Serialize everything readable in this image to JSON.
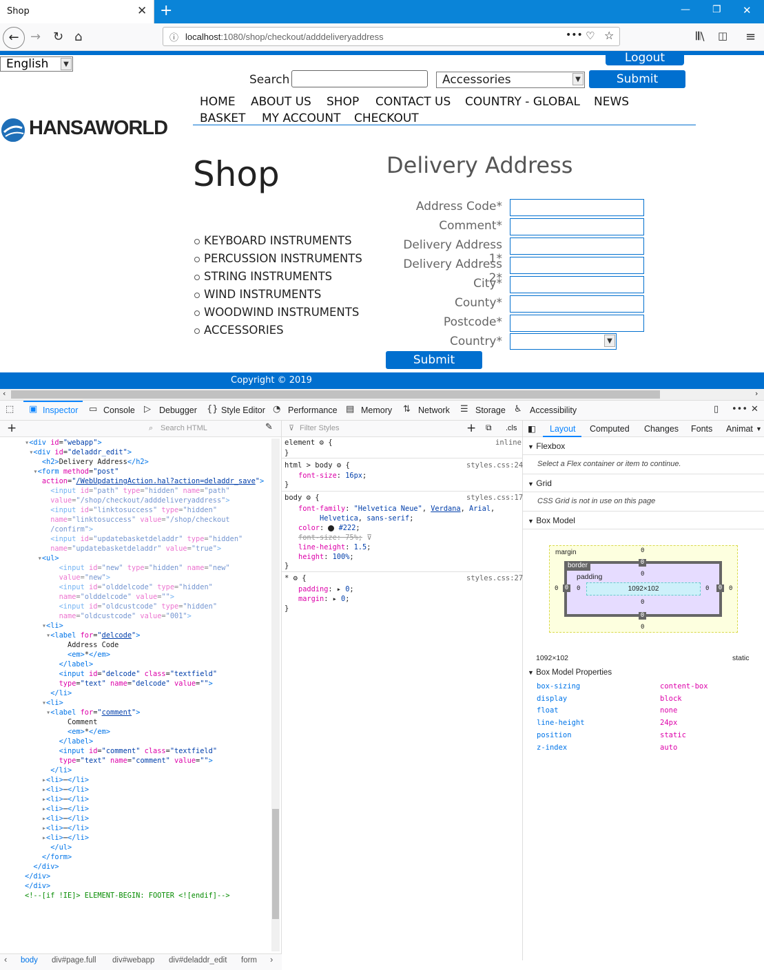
{
  "browser": {
    "tab_title": "Shop",
    "url_host": "localhost",
    "url_rest": ":1080/shop/checkout/adddeliveryaddress",
    "icons": [
      "back-icon",
      "forward-icon",
      "reload-icon",
      "home-icon",
      "info-icon",
      "more-icon",
      "pocket-icon",
      "bookmark-star-icon",
      "library-icon",
      "sidebar-icon",
      "menu-icon"
    ]
  },
  "page": {
    "language": "English",
    "logout": "Logout",
    "search_label": "Search",
    "search_value": "",
    "category_select": "Accessories",
    "submit": "Submit",
    "nav": [
      "HOME",
      "ABOUT US",
      "SHOP",
      "CONTACT US",
      "COUNTRY - GLOBAL",
      "NEWS"
    ],
    "nav2": [
      "BASKET",
      "MY ACCOUNT",
      "CHECKOUT"
    ],
    "logo": "HANSAWORLD",
    "shop_heading": "Shop",
    "categories": [
      "KEYBOARD INSTRUMENTS",
      "PERCUSSION INSTRUMENTS",
      "STRING INSTRUMENTS",
      "WIND INSTRUMENTS",
      "WOODWIND INSTRUMENTS",
      "ACCESSORIES"
    ],
    "form_title": "Delivery Address",
    "fields": [
      "Address Code",
      "Comment",
      "Delivery Address 1",
      "Delivery Address 2",
      "City",
      "County",
      "Postcode",
      "Country"
    ],
    "required_mark": "*",
    "form_submit": "Submit",
    "footer": "Copyright © 2019"
  },
  "devtools": {
    "tabs": [
      "Inspector",
      "Console",
      "Debugger",
      "Style Editor",
      "Performance",
      "Memory",
      "Network",
      "Storage",
      "Accessibility"
    ],
    "search_html": "Search HTML",
    "filter_styles": "Filter Styles",
    "cls": ".cls",
    "right_tabs": [
      "Layout",
      "Computed",
      "Changes",
      "Fonts",
      "Animat"
    ],
    "flexbox": "Flexbox",
    "flexbox_msg": "Select a Flex container or item to continue.",
    "grid": "Grid",
    "grid_msg": "CSS Grid is not in use on this page",
    "box_model": "Box Model",
    "bm_margin": "margin",
    "bm_border": "border",
    "bm_padding": "padding",
    "bm_content": "1092×102",
    "bm_zero": "0",
    "bm_size": "1092×102",
    "bm_position": "static",
    "bm_props_title": "Box Model Properties",
    "bm_props": [
      {
        "k": "box-sizing",
        "v": "content-box"
      },
      {
        "k": "display",
        "v": "block"
      },
      {
        "k": "float",
        "v": "none"
      },
      {
        "k": "line-height",
        "v": "24px"
      },
      {
        "k": "position",
        "v": "static"
      },
      {
        "k": "z-index",
        "v": "auto"
      }
    ],
    "breadcrumb": [
      "body",
      "div#page.full",
      "div#webapp",
      "div#deladdr_edit",
      "form"
    ],
    "styles": {
      "element": "element",
      "inline": "inline",
      "r1_sel": "html > body",
      "r1_src": "styles.css:24",
      "r2_sel": "body",
      "r2_src": "styles.css:17",
      "r3_sel": "*",
      "r3_src": "styles.css:27"
    }
  }
}
